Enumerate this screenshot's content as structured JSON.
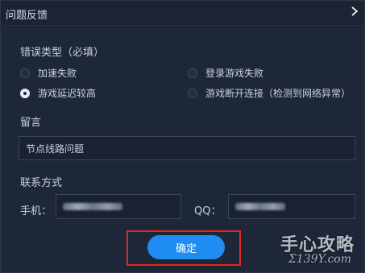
{
  "dialog": {
    "title": "问题反馈"
  },
  "error_type": {
    "label": "错误类型（必填）",
    "options": [
      {
        "label": "加速失败",
        "checked": false
      },
      {
        "label": "登录游戏失败",
        "checked": false
      },
      {
        "label": "游戏延迟较高",
        "checked": true
      },
      {
        "label": "游戏断开连接（检测到网络异常）",
        "checked": false
      }
    ]
  },
  "message": {
    "label": "留言",
    "value": "节点线路问题"
  },
  "contact": {
    "label": "联系方式",
    "phone_label": "手机：",
    "qq_label": "QQ："
  },
  "actions": {
    "confirm_label": "确定"
  },
  "watermark": {
    "text": "手心攻略",
    "sub": "Σ139Y.com"
  },
  "colors": {
    "accent": "#1e8cf0",
    "highlight": "#e02626",
    "background": "#1e2738"
  }
}
